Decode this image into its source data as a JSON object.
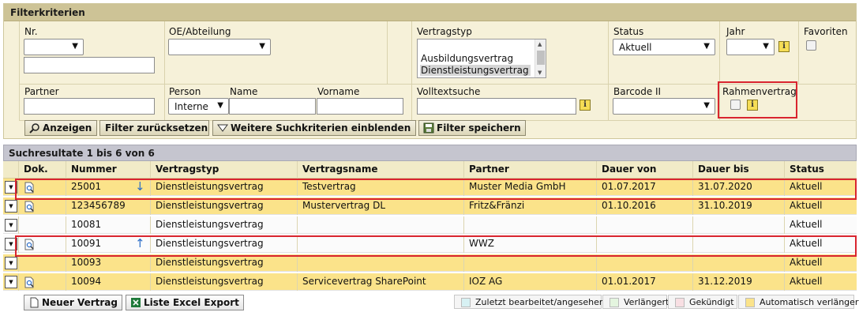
{
  "filter": {
    "title": "Filterkriterien",
    "labels": {
      "nr": "Nr.",
      "oe": "OE/Abteilung",
      "vertragstyp": "Vertragstyp",
      "status": "Status",
      "jahr": "Jahr",
      "favoriten": "Favoriten",
      "partner": "Partner",
      "person": "Person",
      "name": "Name",
      "vorname": "Vorname",
      "volltext": "Volltextsuche",
      "barcode": "Barcode II",
      "rahmenvertrag": "Rahmenvertrag"
    },
    "vertragstyp_options": [
      "Ausbildungsvertrag",
      "Dienstleistungsvertrag"
    ],
    "vertragstyp_selected": "Dienstleistungsvertrag",
    "status_value": "Aktuell",
    "person_value": "Interne",
    "info_glyph": "i",
    "buttons": {
      "anzeigen": "Anzeigen",
      "reset": "Filter zurücksetzen",
      "more": "Weitere Suchkriterien einblenden",
      "save": "Filter speichern"
    }
  },
  "results": {
    "title": "Suchresultate 1 bis 6 von 6",
    "columns": [
      "Dok.",
      "Nummer",
      "Vertragstyp",
      "Vertragsname",
      "Partner",
      "Dauer von",
      "Dauer bis",
      "Status"
    ],
    "rows": [
      {
        "doc": true,
        "nummer": "25001",
        "sort": "down",
        "typ": "Dienstleistungsvertrag",
        "name": "Testvertrag",
        "partner": "Muster Media GmbH",
        "von": "01.07.2017",
        "bis": "31.07.2020",
        "status": "Aktuell",
        "bg": "yellow"
      },
      {
        "doc": true,
        "nummer": "123456789",
        "sort": "",
        "typ": "Dienstleistungsvertrag",
        "name": "Mustervertrag DL",
        "partner": "Fritz&Fränzi",
        "von": "01.10.2016",
        "bis": "31.10.2019",
        "status": "Aktuell",
        "bg": "yellow"
      },
      {
        "doc": false,
        "nummer": "10081",
        "sort": "",
        "typ": "Dienstleistungsvertrag",
        "name": "",
        "partner": "",
        "von": "",
        "bis": "",
        "status": "Aktuell",
        "bg": "white"
      },
      {
        "doc": true,
        "nummer": "10091",
        "sort": "up",
        "typ": "Dienstleistungsvertrag",
        "name": "",
        "partner": "WWZ",
        "von": "",
        "bis": "",
        "status": "Aktuell",
        "bg": "white"
      },
      {
        "doc": false,
        "nummer": "10093",
        "sort": "",
        "typ": "Dienstleistungsvertrag",
        "name": "",
        "partner": "",
        "von": "",
        "bis": "",
        "status": "Aktuell",
        "bg": "yellow"
      },
      {
        "doc": true,
        "nummer": "10094",
        "sort": "",
        "typ": "Dienstleistungsvertrag",
        "name": "Servicevertrag SharePoint",
        "partner": "IOZ AG",
        "von": "01.01.2017",
        "bis": "31.12.2019",
        "status": "Aktuell",
        "bg": "yellow"
      }
    ]
  },
  "actions": {
    "new": "Neuer Vertrag",
    "export": "Liste Excel Export"
  },
  "legend": [
    {
      "label": "Zuletzt bearbeitet/angesehen",
      "color": "#d7f1f3"
    },
    {
      "label": "Verlängert",
      "color": "#e4f5df"
    },
    {
      "label": "Gekündigt",
      "color": "#f8dfe3"
    },
    {
      "label": "Automatisch verlängert",
      "color": "#fbe38a"
    }
  ],
  "colors": {
    "highlight": "#d9252f",
    "row_yellow": "#fbe38a",
    "sort_arrow": "#2d6ec8"
  }
}
